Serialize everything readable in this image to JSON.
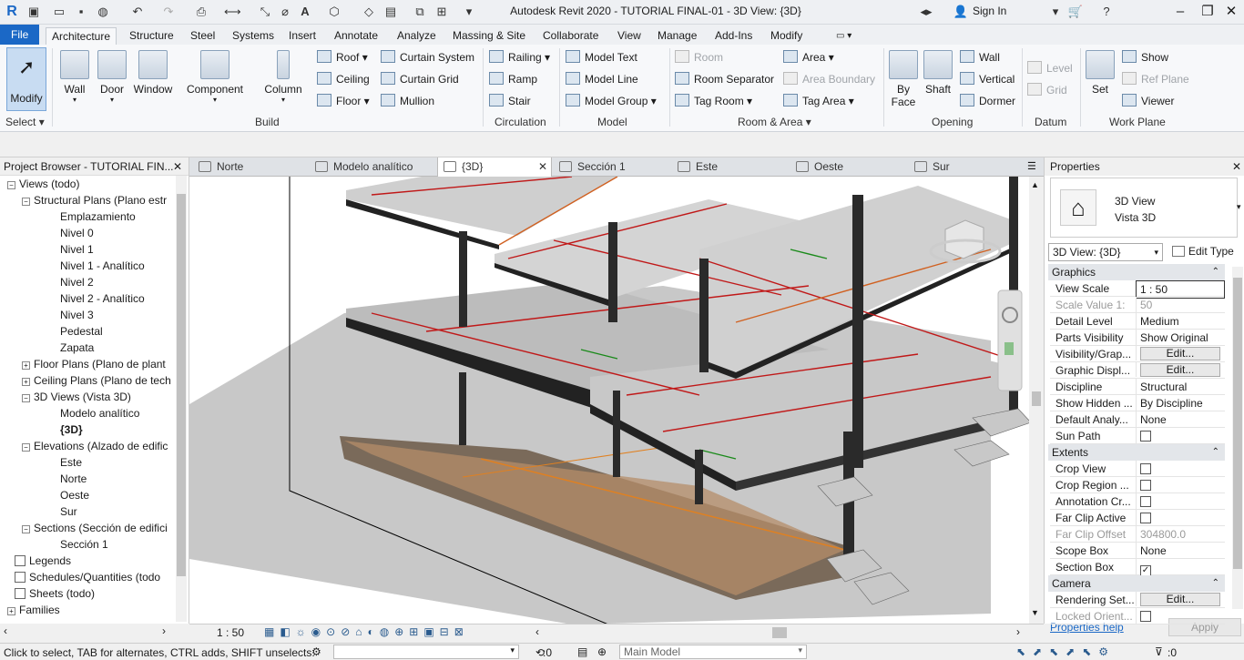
{
  "app": {
    "title": "Autodesk Revit 2020 - TUTORIAL FINAL-01 - 3D View: {3D}",
    "sign_in": "Sign In"
  },
  "ribbon_tabs": [
    "File",
    "Architecture",
    "Structure",
    "Steel",
    "Systems",
    "Insert",
    "Annotate",
    "Analyze",
    "Massing & Site",
    "Collaborate",
    "View",
    "Manage",
    "Add-Ins",
    "Modify"
  ],
  "ribbon": {
    "select": {
      "modify": "Modify",
      "select_label": "Select"
    },
    "build": {
      "wall": "Wall",
      "door": "Door",
      "window": "Window",
      "component": "Component",
      "column": "Column",
      "roof": "Roof",
      "ceiling": "Ceiling",
      "floor": "Floor",
      "curtain_system": "Curtain System",
      "curtain_grid": "Curtain Grid",
      "mullion": "Mullion",
      "label": "Build"
    },
    "circulation": {
      "railing": "Railing",
      "ramp": "Ramp",
      "stair": "Stair",
      "label": "Circulation"
    },
    "model": {
      "model_text": "Model Text",
      "model_line": "Model Line",
      "model_group": "Model Group",
      "label": "Model"
    },
    "room_area": {
      "room": "Room",
      "room_separator": "Room Separator",
      "tag_room": "Tag Room",
      "area": "Area",
      "area_boundary": "Area Boundary",
      "tag_area": "Tag Area",
      "label": "Room & Area"
    },
    "opening": {
      "by_face_1": "By",
      "by_face_2": "Face",
      "shaft": "Shaft",
      "wall": "Wall",
      "vertical": "Vertical",
      "dormer": "Dormer",
      "label": "Opening"
    },
    "datum": {
      "level": "Level",
      "grid": "Grid",
      "label": "Datum"
    },
    "work_plane": {
      "set": "Set",
      "show": "Show",
      "ref_plane": "Ref  Plane",
      "viewer": "Viewer",
      "label": "Work Plane"
    }
  },
  "browser": {
    "title": "Project Browser - TUTORIAL FIN...",
    "items": [
      {
        "label": "Views (todo)",
        "toggle": "−"
      },
      {
        "label": "Structural Plans (Plano estr",
        "toggle": "−"
      },
      {
        "label": "Emplazamiento"
      },
      {
        "label": "Nivel 0"
      },
      {
        "label": "Nivel 1"
      },
      {
        "label": "Nivel 1 - Analítico"
      },
      {
        "label": "Nivel 2"
      },
      {
        "label": "Nivel 2 - Analítico"
      },
      {
        "label": "Nivel 3"
      },
      {
        "label": "Pedestal"
      },
      {
        "label": "Zapata"
      },
      {
        "label": "Floor Plans (Plano de plant",
        "toggle": "+"
      },
      {
        "label": "Ceiling Plans (Plano de tech",
        "toggle": "+"
      },
      {
        "label": "3D Views (Vista 3D)",
        "toggle": "−"
      },
      {
        "label": "Modelo analítico"
      },
      {
        "label": "{3D}"
      },
      {
        "label": "Elevations (Alzado de edific",
        "toggle": "−"
      },
      {
        "label": "Este"
      },
      {
        "label": "Norte"
      },
      {
        "label": "Oeste"
      },
      {
        "label": "Sur"
      },
      {
        "label": "Sections (Sección de edifici",
        "toggle": "−"
      },
      {
        "label": "Sección 1"
      },
      {
        "label": "Legends"
      },
      {
        "label": "Schedules/Quantities (todo"
      },
      {
        "label": "Sheets (todo)"
      },
      {
        "label": "Families",
        "toggle": "+"
      }
    ]
  },
  "view_tabs": [
    "Norte",
    "Modelo analítico",
    "{3D}",
    "Sección 1",
    "Este",
    "Oeste",
    "Sur"
  ],
  "properties": {
    "title": "Properties",
    "type_line1": "3D View",
    "type_line2": "Vista 3D",
    "instance": "3D View: {3D}",
    "edit_type": "Edit Type",
    "groups": {
      "graphics": "Graphics",
      "extents": "Extents",
      "camera": "Camera"
    },
    "rows": [
      {
        "label": "View Scale",
        "value": "1 : 50"
      },
      {
        "label": "Scale Value    1:",
        "value": "50"
      },
      {
        "label": "Detail Level",
        "value": "Medium"
      },
      {
        "label": "Parts Visibility",
        "value": "Show Original"
      },
      {
        "label": "Visibility/Grap...",
        "value": "Edit..."
      },
      {
        "label": "Graphic Displ...",
        "value": "Edit..."
      },
      {
        "label": "Discipline",
        "value": "Structural"
      },
      {
        "label": "Show Hidden ...",
        "value": "By Discipline"
      },
      {
        "label": "Default Analy...",
        "value": "None"
      },
      {
        "label": "Sun Path",
        "value": ""
      },
      {
        "label": "Crop View",
        "value": ""
      },
      {
        "label": "Crop Region ...",
        "value": ""
      },
      {
        "label": "Annotation Cr...",
        "value": ""
      },
      {
        "label": "Far Clip Active",
        "value": ""
      },
      {
        "label": "Far Clip Offset",
        "value": "304800.0"
      },
      {
        "label": "Scope Box",
        "value": "None"
      },
      {
        "label": "Section Box",
        "value": "✓"
      },
      {
        "label": "Rendering Set...",
        "value": "Edit..."
      },
      {
        "label": "Locked Orient...",
        "value": ""
      }
    ],
    "help": "Properties help",
    "apply": "Apply"
  },
  "view_bar": {
    "scale": "1 : 50"
  },
  "status": {
    "text": "Click to select, TAB for alternates, CTRL adds, SHIFT unselects.",
    "count": ":0",
    "workset": "Main Model"
  },
  "colors": {
    "accent": "#1b68c6",
    "selected_bg": "#c8dcf2"
  }
}
